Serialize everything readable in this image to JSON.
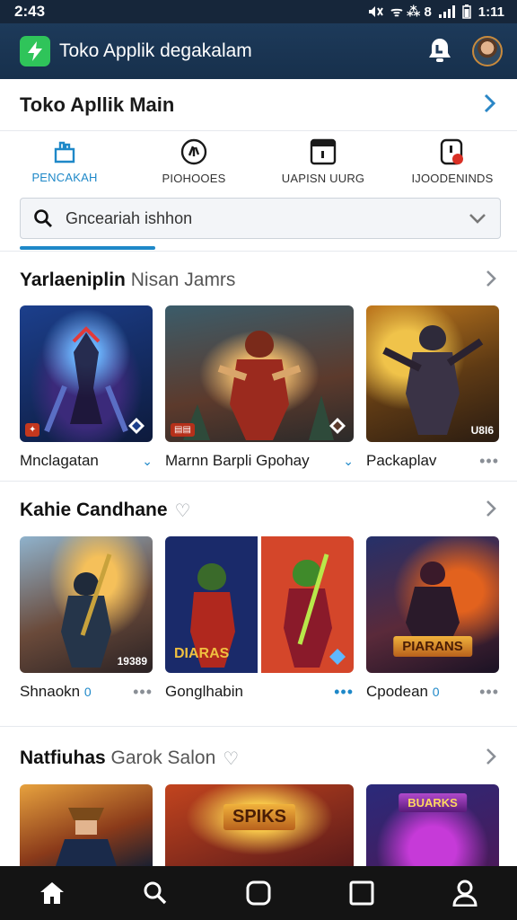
{
  "status_bar": {
    "time": "2:43",
    "net": "ᯤ ⁂ 8",
    "clock": "1:11"
  },
  "app_bar": {
    "title": "Toko Applik degakalam"
  },
  "header": {
    "title": "Toko Apllik Main"
  },
  "tabs": [
    {
      "label": "PENCAKAH",
      "icon": "store-icon",
      "active": true
    },
    {
      "label": "PIOHOOES",
      "icon": "compass-icon",
      "active": false
    },
    {
      "label": "UAPISN UURG",
      "icon": "calendar-icon",
      "active": false
    },
    {
      "label": "IJOODENINDS",
      "icon": "notification-icon",
      "active": false
    }
  ],
  "search": {
    "value": "Gnceariah ishhon"
  },
  "sections": [
    {
      "title": "Yarlaeniplin",
      "subtitle": "Nisan Jamrs",
      "items": [
        {
          "caption": "Mnclagatan",
          "marker": "⌄",
          "overlay": ""
        },
        {
          "caption": "Marnn Barpli Gpohay",
          "marker": "⌄",
          "overlay": ""
        },
        {
          "caption": "Packaplav",
          "marker": "•••",
          "overlay": "U8I6"
        }
      ]
    },
    {
      "title": "Kahie Candhane",
      "subtitle": "",
      "items": [
        {
          "caption": "Shnaokn",
          "badge": "0",
          "marker": "•••",
          "overlay": "19389"
        },
        {
          "caption": "Gonglhabin",
          "badge": "",
          "marker": "•••",
          "overlay": "DIARAS"
        },
        {
          "caption": "Cpodean",
          "badge": "0",
          "marker": "•••",
          "overlay": "PIARANS"
        }
      ]
    },
    {
      "title": "Natfiuhas",
      "subtitle": "Garok Salon",
      "items": [
        {
          "caption": "",
          "overlay": ""
        },
        {
          "caption": "",
          "overlay": "SPIKS"
        },
        {
          "caption": "",
          "overlay": "BUARKS"
        }
      ]
    }
  ],
  "colors": {
    "accent": "#1e88c8",
    "app_bar": "#1d3a5a",
    "logo": "#2fc45a"
  }
}
